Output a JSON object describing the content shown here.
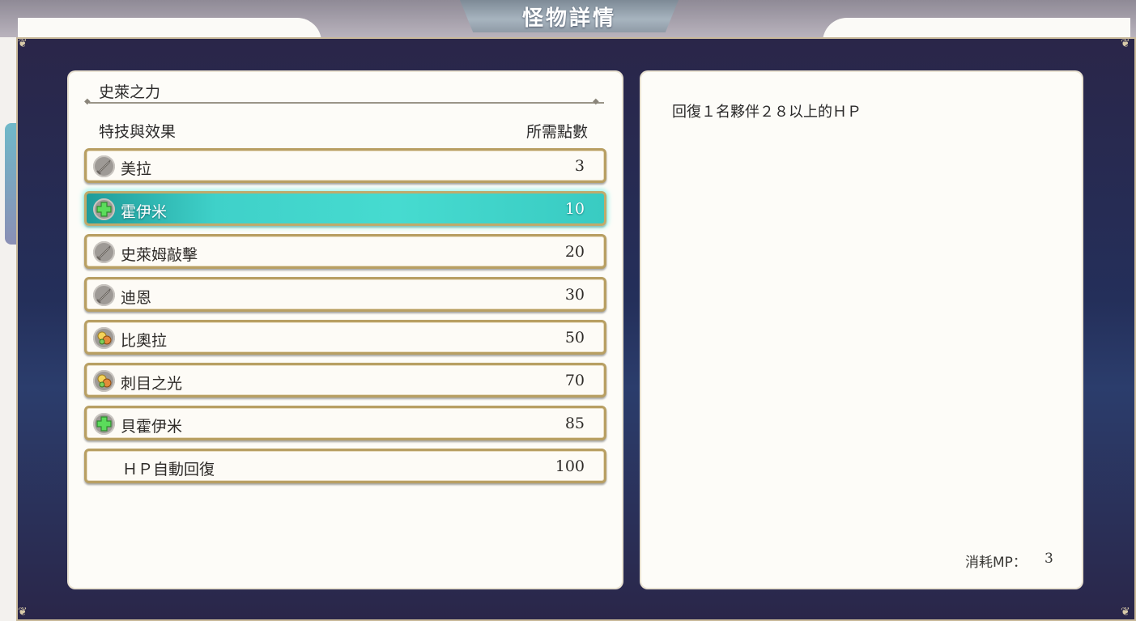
{
  "screen_title": "怪物詳情",
  "monster": {
    "name": "史萊之力"
  },
  "skill_list": {
    "header_skill": "特技與效果",
    "header_points": "所需點數",
    "items": [
      {
        "name": "美拉",
        "points": "3",
        "icon": "sword-icon",
        "selected": false
      },
      {
        "name": "霍伊米",
        "points": "10",
        "icon": "heal-cross-icon",
        "selected": true
      },
      {
        "name": "史萊姆敲擊",
        "points": "20",
        "icon": "sword-icon",
        "selected": false
      },
      {
        "name": "迪恩",
        "points": "30",
        "icon": "sword-icon",
        "selected": false
      },
      {
        "name": "比奧拉",
        "points": "50",
        "icon": "buff-sparkle-icon",
        "selected": false
      },
      {
        "name": "刺目之光",
        "points": "70",
        "icon": "buff-sparkle-icon",
        "selected": false
      },
      {
        "name": "貝霍伊米",
        "points": "85",
        "icon": "heal-cross-icon",
        "selected": false
      },
      {
        "name": "ＨＰ自動回復",
        "points": "100",
        "icon": "",
        "selected": false
      }
    ]
  },
  "detail": {
    "description": "回復１名夥伴２８以上的ＨＰ",
    "mp_label": "消耗MP：",
    "mp_value": "3"
  },
  "colors": {
    "selected_row": "#46dbd0",
    "row_border": "#b89f63",
    "frame_bg": "#2a2649",
    "panel_bg": "#fdfcf8"
  }
}
